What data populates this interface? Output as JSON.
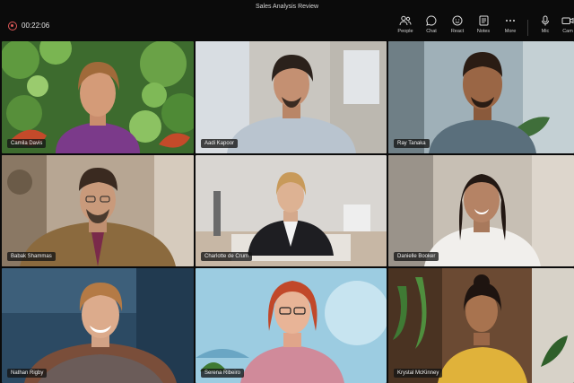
{
  "window": {
    "title": "Sales Analysis Review"
  },
  "meeting": {
    "timer": "00:22:06"
  },
  "controls": [
    {
      "label": "People",
      "icon": "people-icon"
    },
    {
      "label": "Chat",
      "icon": "chat-icon"
    },
    {
      "label": "React",
      "icon": "react-icon"
    },
    {
      "label": "Notes",
      "icon": "notes-icon"
    },
    {
      "label": "More",
      "icon": "more-icon"
    },
    {
      "label": "Mic",
      "icon": "mic-icon"
    },
    {
      "label": "Cam",
      "icon": "camera-icon"
    }
  ],
  "participants": [
    {
      "name": "Camila Davis"
    },
    {
      "name": "Aadi Kapoor"
    },
    {
      "name": "Ray Tanaka"
    },
    {
      "name": "Babak Shammas"
    },
    {
      "name": "Charlotte de Crum"
    },
    {
      "name": "Danielle Booker"
    },
    {
      "name": "Nathan Rigby"
    },
    {
      "name": "Serena Ribeiro"
    },
    {
      "name": "Krystal McKinney"
    }
  ]
}
